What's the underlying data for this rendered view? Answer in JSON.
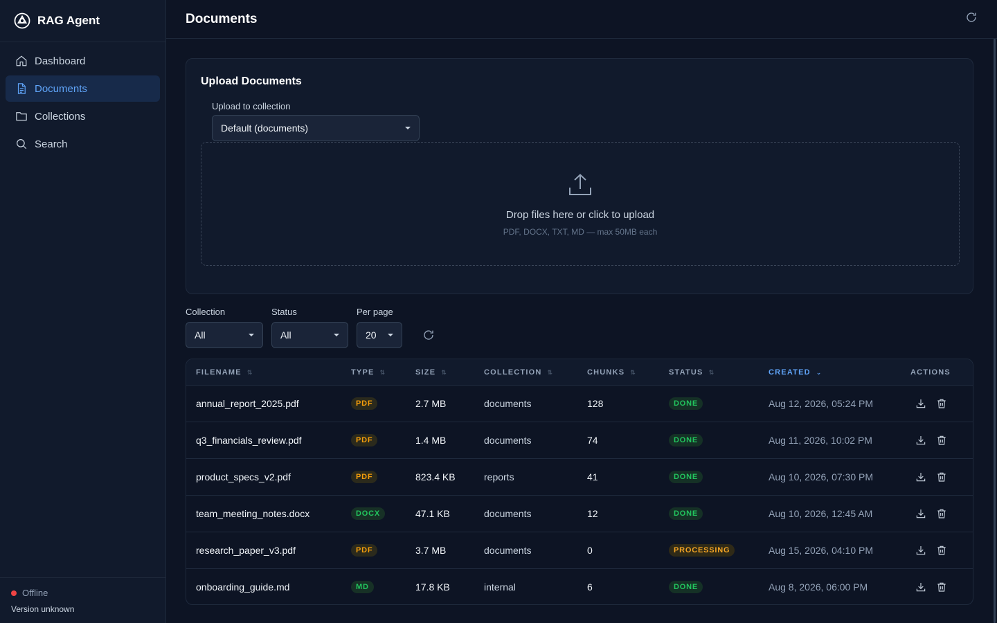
{
  "app": {
    "name": "RAG Agent"
  },
  "sidebar": {
    "items": [
      {
        "label": "Dashboard",
        "icon": "home-icon"
      },
      {
        "label": "Documents",
        "icon": "document-icon",
        "active": true
      },
      {
        "label": "Collections",
        "icon": "folder-icon"
      },
      {
        "label": "Search",
        "icon": "search-icon"
      }
    ],
    "status": "Offline",
    "version": "Version unknown"
  },
  "header": {
    "title": "Documents"
  },
  "upload": {
    "title": "Upload Documents",
    "collection_label": "Upload to collection",
    "collection_value": "Default (documents)",
    "drop_text": "Drop files here or click to upload",
    "drop_hint": "PDF, DOCX, TXT, MD — max 50MB each"
  },
  "filters": {
    "collection": {
      "label": "Collection",
      "value": "All"
    },
    "status": {
      "label": "Status",
      "value": "All"
    },
    "per_page": {
      "label": "Per page",
      "value": "20"
    }
  },
  "table": {
    "columns": [
      "FILENAME",
      "TYPE",
      "SIZE",
      "COLLECTION",
      "CHUNKS",
      "STATUS",
      "CREATED",
      "ACTIONS"
    ],
    "sorted_column": "CREATED",
    "rows": [
      {
        "filename": "annual_report_2025.pdf",
        "type": "PDF",
        "size": "2.7 MB",
        "collection": "documents",
        "chunks": "128",
        "status": "DONE",
        "created": "Aug 12, 2026, 05:24 PM"
      },
      {
        "filename": "q3_financials_review.pdf",
        "type": "PDF",
        "size": "1.4 MB",
        "collection": "documents",
        "chunks": "74",
        "status": "DONE",
        "created": "Aug 11, 2026, 10:02 PM"
      },
      {
        "filename": "product_specs_v2.pdf",
        "type": "PDF",
        "size": "823.4 KB",
        "collection": "reports",
        "chunks": "41",
        "status": "DONE",
        "created": "Aug 10, 2026, 07:30 PM"
      },
      {
        "filename": "team_meeting_notes.docx",
        "type": "DOCX",
        "size": "47.1 KB",
        "collection": "documents",
        "chunks": "12",
        "status": "DONE",
        "created": "Aug 10, 2026, 12:45 AM"
      },
      {
        "filename": "research_paper_v3.pdf",
        "type": "PDF",
        "size": "3.7 MB",
        "collection": "documents",
        "chunks": "0",
        "status": "PROCESSING",
        "created": "Aug 15, 2026, 04:10 PM"
      },
      {
        "filename": "onboarding_guide.md",
        "type": "MD",
        "size": "17.8 KB",
        "collection": "internal",
        "chunks": "6",
        "status": "DONE",
        "created": "Aug 8, 2026, 06:00 PM"
      }
    ]
  },
  "colors": {
    "accent": "#60a5fa",
    "done": "#22c55e",
    "processing": "#f5a524",
    "pdf": "#f59e0b",
    "offline": "#ef4444"
  }
}
